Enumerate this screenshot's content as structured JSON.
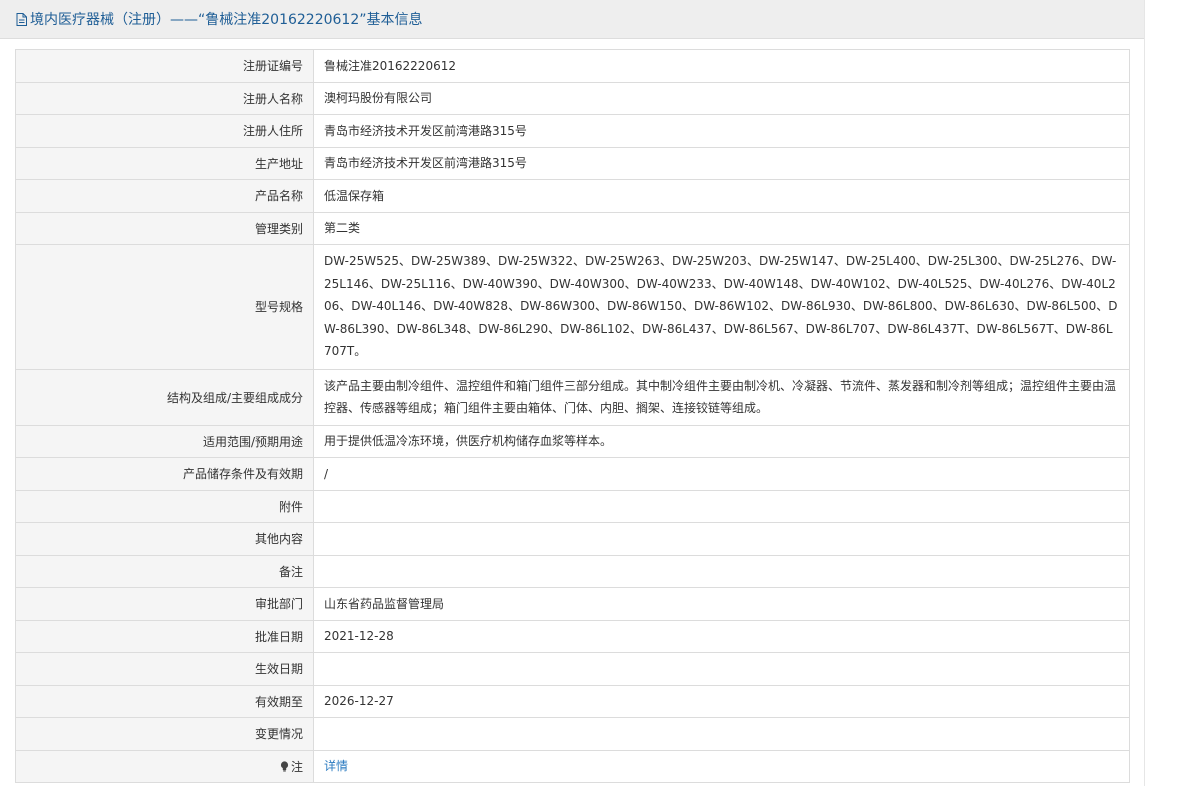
{
  "header": {
    "title": "境内医疗器械（注册）——“鲁械注准20162220612”基本信息"
  },
  "rows": [
    {
      "label": "注册证编号",
      "value": "鲁械注准20162220612"
    },
    {
      "label": "注册人名称",
      "value": "澳柯玛股份有限公司"
    },
    {
      "label": "注册人住所",
      "value": "青岛市经济技术开发区前湾港路315号"
    },
    {
      "label": "生产地址",
      "value": "青岛市经济技术开发区前湾港路315号"
    },
    {
      "label": "产品名称",
      "value": "低温保存箱"
    },
    {
      "label": "管理类别",
      "value": "第二类"
    },
    {
      "label": "型号规格",
      "value": "DW-25W525、DW-25W389、DW-25W322、DW-25W263、DW-25W203、DW-25W147、DW-25L400、DW-25L300、DW-25L276、DW-25L146、DW-25L116、DW-40W390、DW-40W300、DW-40W233、DW-40W148、DW-40W102、DW-40L525、DW-40L276、DW-40L206、DW-40L146、DW-40W828、DW-86W300、DW-86W150、DW-86W102、DW-86L930、DW-86L800、DW-86L630、DW-86L500、DW-86L390、DW-86L348、DW-86L290、DW-86L102、DW-86L437、DW-86L567、DW-86L707、DW-86L437T、DW-86L567T、DW-86L707T。"
    },
    {
      "label": "结构及组成/主要组成成分",
      "value": "该产品主要由制冷组件、温控组件和箱门组件三部分组成。其中制冷组件主要由制冷机、冷凝器、节流件、蒸发器和制冷剂等组成；温控组件主要由温控器、传感器等组成；箱门组件主要由箱体、门体、内胆、搁架、连接铰链等组成。"
    },
    {
      "label": "适用范围/预期用途",
      "value": "用于提供低温冷冻环境，供医疗机构储存血浆等样本。"
    },
    {
      "label": "产品储存条件及有效期",
      "value": "/"
    },
    {
      "label": "附件",
      "value": ""
    },
    {
      "label": "其他内容",
      "value": ""
    },
    {
      "label": "备注",
      "value": ""
    },
    {
      "label": "审批部门",
      "value": "山东省药品监督管理局"
    },
    {
      "label": "批准日期",
      "value": "2021-12-28"
    },
    {
      "label": "生效日期",
      "value": ""
    },
    {
      "label": "有效期至",
      "value": "2026-12-27"
    },
    {
      "label": "变更情况",
      "value": ""
    }
  ],
  "note_row": {
    "label": "注",
    "icon": "lightbulb-icon",
    "link_text": "详情"
  },
  "colors": {
    "header_text": "#1f5e96",
    "link": "#2a7ac0",
    "label_bg": "#f5f5f5",
    "border": "#dcdcdc"
  }
}
